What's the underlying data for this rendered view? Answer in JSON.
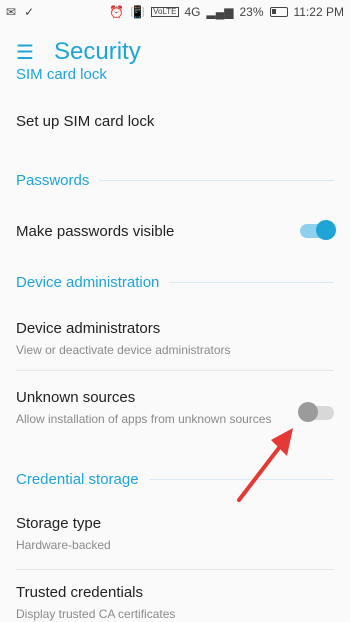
{
  "status_bar": {
    "left_icons": [
      "gmail-icon",
      "check-icon"
    ],
    "right_icons": [
      "alarm-icon",
      "vibrate-icon",
      "volte-icon",
      "4g-icon",
      "signal-icon",
      "battery-icon"
    ],
    "network": "4G",
    "battery": "23%",
    "time": "11:22 PM"
  },
  "app_bar": {
    "title": "Security",
    "menu_icon": "hamburger-menu-icon"
  },
  "sections": {
    "sim_card_lock": {
      "header": "SIM card lock",
      "item": "Set up SIM card lock"
    },
    "passwords": {
      "header": "Passwords",
      "item": "Make passwords visible",
      "toggle_on": true
    },
    "device_admin": {
      "header": "Device administration",
      "admins_title": "Device administrators",
      "admins_sub": "View or deactivate device administrators",
      "unknown_title": "Unknown sources",
      "unknown_sub": "Allow installation of apps from unknown sources",
      "unknown_toggle_on": false
    },
    "credential_storage": {
      "header": "Credential storage",
      "storage_title": "Storage type",
      "storage_sub": "Hardware-backed",
      "trusted_title": "Trusted credentials",
      "trusted_sub": "Display trusted CA certificates"
    }
  },
  "colors": {
    "accent": "#1fa4d6",
    "annotation_arrow": "#e53935"
  }
}
